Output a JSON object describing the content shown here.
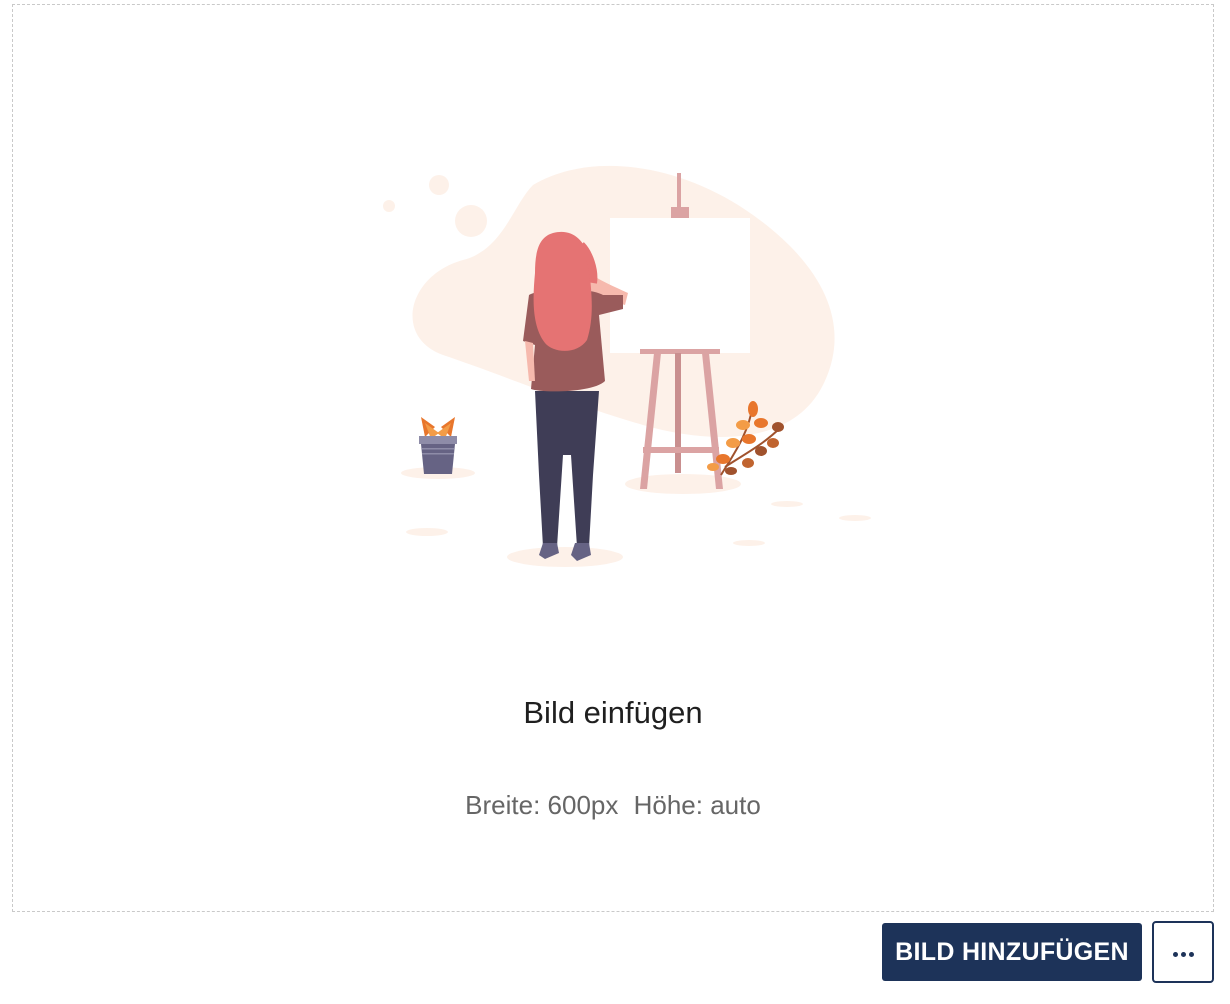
{
  "dropzone": {
    "title": "Bild einfügen",
    "width_label": "Breite: 600px",
    "height_label": "Höhe: auto"
  },
  "actions": {
    "add_image_label": "BILD HINZUFÜGEN",
    "more_icon": "more-dots-icon"
  },
  "colors": {
    "primary": "#1d3359",
    "blob": "#fdf1e9",
    "hair": "#e57373",
    "shirt": "#9a5b5b",
    "pants": "#3f3d56",
    "easel": "#dba3a3",
    "leaves": "#e8762c"
  }
}
